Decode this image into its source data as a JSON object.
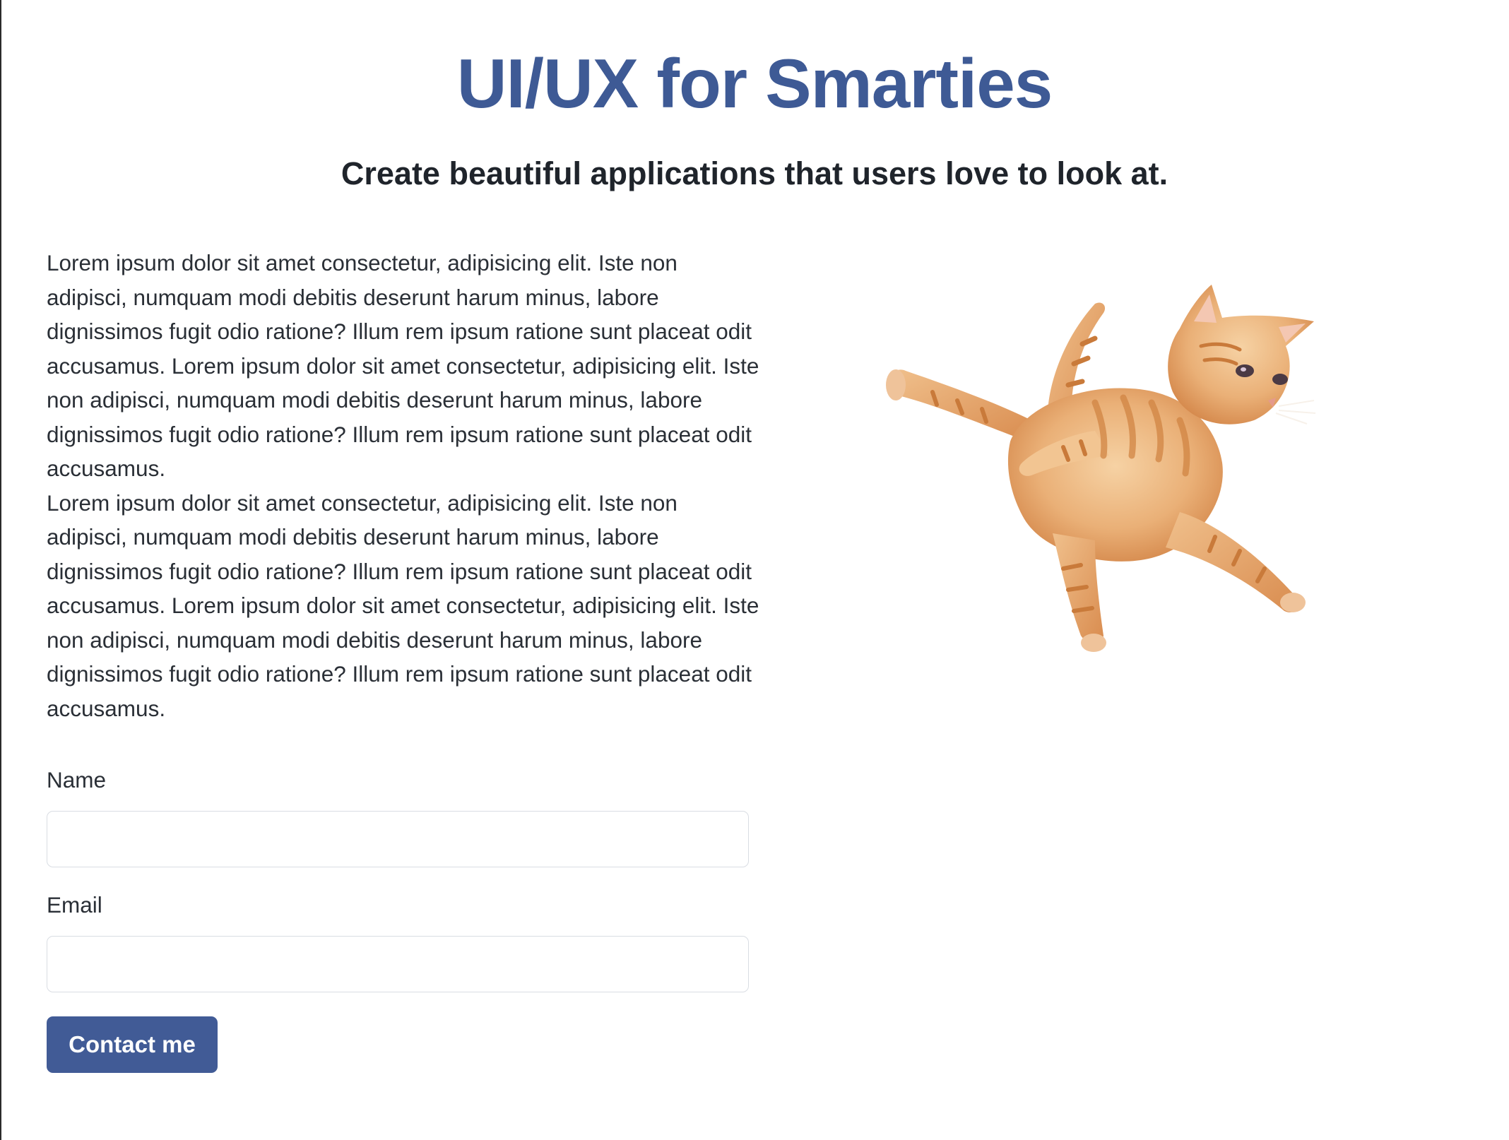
{
  "header": {
    "title": "UI/UX for Smarties",
    "subtitle": "Create beautiful applications that users love to look at."
  },
  "content": {
    "paragraphs": [
      "Lorem ipsum dolor sit amet consectetur, adipisicing elit. Iste non adipisci, numquam modi debitis deserunt harum minus, labore dignissimos fugit odio ratione? Illum rem ipsum ratione sunt placeat odit accusamus. Lorem ipsum dolor sit amet consectetur, adipisicing elit. Iste non adipisci, numquam modi debitis deserunt harum minus, labore dignissimos fugit odio ratione? Illum rem ipsum ratione sunt placeat odit accusamus.",
      "Lorem ipsum dolor sit amet consectetur, adipisicing elit. Iste non adipisci, numquam modi debitis deserunt harum minus, labore dignissimos fugit odio ratione? Illum rem ipsum ratione sunt placeat odit accusamus. Lorem ipsum dolor sit amet consectetur, adipisicing elit. Iste non adipisci, numquam modi debitis deserunt harum minus, labore dignissimos fugit odio ratione? Illum rem ipsum ratione sunt placeat odit accusamus."
    ]
  },
  "form": {
    "name_label": "Name",
    "name_value": "",
    "email_label": "Email",
    "email_value": "",
    "submit_label": "Contact me"
  },
  "image": {
    "icon": "leaping-cat-image"
  },
  "colors": {
    "title": "#3e5a95",
    "button": "#415b96",
    "cat_fur": "#e9a764"
  }
}
